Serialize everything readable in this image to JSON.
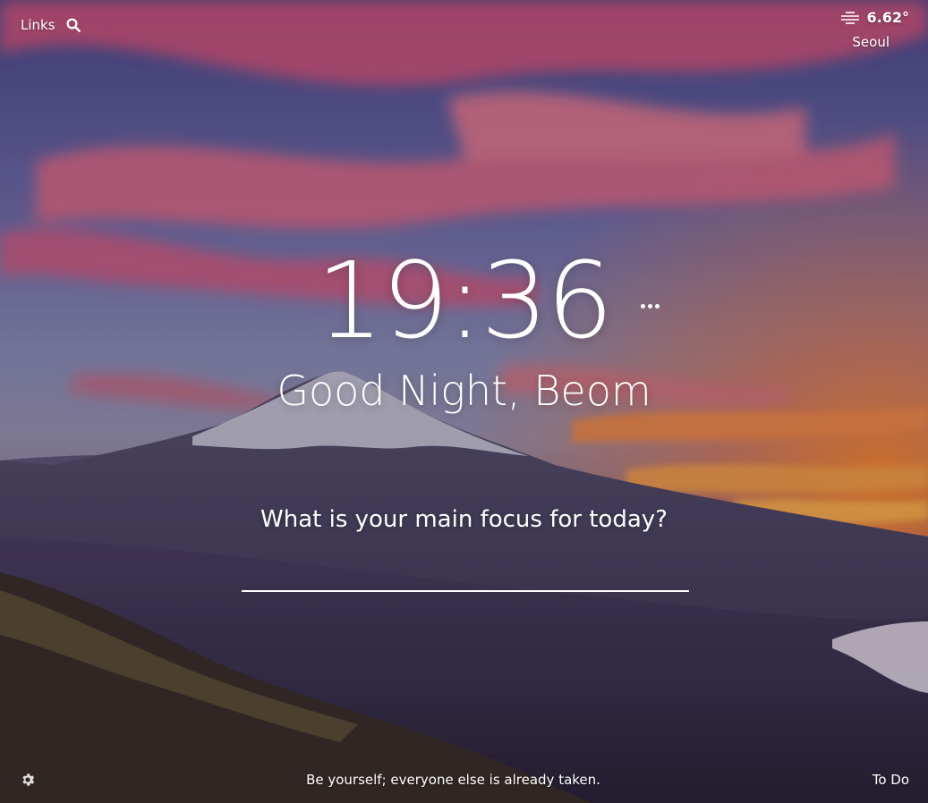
{
  "links": {
    "label": "Links",
    "icon": "search-icon"
  },
  "weather": {
    "icon": "fog-icon",
    "temperature": "6.62°",
    "city": "Seoul"
  },
  "clock": {
    "time": "19:36"
  },
  "greeting": {
    "text": "Good Night, Beom"
  },
  "focus": {
    "question": "What is your main focus for today?",
    "value": ""
  },
  "footer": {
    "settings_icon": "gear-icon",
    "quote": "Be yourself; everyone else is already taken.",
    "todo_label": "To Do"
  }
}
